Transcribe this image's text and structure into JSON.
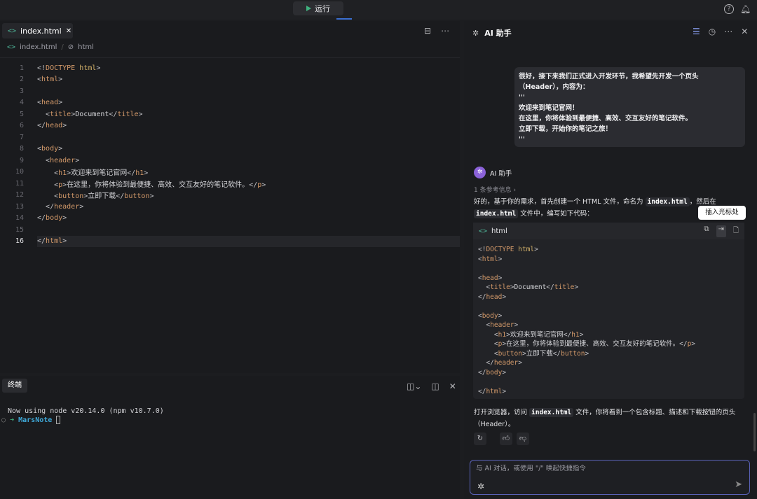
{
  "topbar": {
    "run_label": "运行"
  },
  "editor": {
    "tab_label": "index.html",
    "breadcrumb": [
      "index.html",
      "html"
    ],
    "lines": [
      [
        [
          "p",
          "<!"
        ],
        [
          "k",
          "DOCTYPE"
        ],
        [
          "t",
          " "
        ],
        [
          "d",
          "html"
        ],
        [
          "p",
          ">"
        ]
      ],
      [
        [
          "p",
          "<"
        ],
        [
          "k",
          "html"
        ],
        [
          "p",
          ">"
        ]
      ],
      [],
      [
        [
          "p",
          "<"
        ],
        [
          "k",
          "head"
        ],
        [
          "p",
          ">"
        ]
      ],
      [
        [
          "t",
          "  "
        ],
        [
          "p",
          "<"
        ],
        [
          "k",
          "title"
        ],
        [
          "p",
          ">"
        ],
        [
          "t",
          "Document"
        ],
        [
          "p",
          "</"
        ],
        [
          "k",
          "title"
        ],
        [
          "p",
          ">"
        ]
      ],
      [
        [
          "p",
          "</"
        ],
        [
          "k",
          "head"
        ],
        [
          "p",
          ">"
        ]
      ],
      [],
      [
        [
          "p",
          "<"
        ],
        [
          "k",
          "body"
        ],
        [
          "p",
          ">"
        ]
      ],
      [
        [
          "t",
          "  "
        ],
        [
          "p",
          "<"
        ],
        [
          "k",
          "header"
        ],
        [
          "p",
          ">"
        ]
      ],
      [
        [
          "t",
          "    "
        ],
        [
          "p",
          "<"
        ],
        [
          "k",
          "h1"
        ],
        [
          "p",
          ">"
        ],
        [
          "t",
          "欢迎来到笔记官网"
        ],
        [
          "p",
          "</"
        ],
        [
          "k",
          "h1"
        ],
        [
          "p",
          ">"
        ]
      ],
      [
        [
          "t",
          "    "
        ],
        [
          "p",
          "<"
        ],
        [
          "k",
          "p"
        ],
        [
          "p",
          ">"
        ],
        [
          "t",
          "在这里，你将体验到最便捷、高效、交互友好的笔记软件。"
        ],
        [
          "p",
          "</"
        ],
        [
          "k",
          "p"
        ],
        [
          "p",
          ">"
        ]
      ],
      [
        [
          "t",
          "    "
        ],
        [
          "p",
          "<"
        ],
        [
          "k",
          "button"
        ],
        [
          "p",
          ">"
        ],
        [
          "t",
          "立即下载"
        ],
        [
          "p",
          "</"
        ],
        [
          "k",
          "button"
        ],
        [
          "p",
          ">"
        ]
      ],
      [
        [
          "t",
          "  "
        ],
        [
          "p",
          "</"
        ],
        [
          "k",
          "header"
        ],
        [
          "p",
          ">"
        ]
      ],
      [
        [
          "p",
          "</"
        ],
        [
          "k",
          "body"
        ],
        [
          "p",
          ">"
        ]
      ],
      [],
      [
        [
          "p",
          "</"
        ],
        [
          "k",
          "html"
        ],
        [
          "p",
          ">"
        ]
      ]
    ],
    "current_line": 16
  },
  "terminal": {
    "tab_label": "终端",
    "line1": "Now using node v20.14.0 (npm v10.7.0)",
    "prompt_dir": "MarsNote"
  },
  "assistant": {
    "title": "AI 助手",
    "user_message": [
      "很好，接下来我们正式进入开发环节，我希望先开发一个页头",
      "（Header），内容为：",
      "'''",
      "欢迎来到笔记官网！",
      "在这里，你将体验到最便捷、高效、交互友好的笔记软件。",
      "立即下载，开始你的笔记之旅！",
      "'''"
    ],
    "bot_name": "AI 助手",
    "references": "1 条参考信息",
    "intro_a": "好的，基于你的需求，首先创建一个 HTML 文件，命名为",
    "intro_code": "index.html",
    "intro_b": "，然后在",
    "intro_code2": "index.html",
    "intro_c": "文件中，编写如下代码：",
    "code_lang": "html",
    "tooltip": "插入光标处",
    "outro_a": "打开浏览器，访问",
    "outro_code": "index.html",
    "outro_b": "文件，你将看到一个包含标题、描述和下载按钮的页头（Header）。",
    "input_placeholder": "与 AI 对话，或使用 \"/\" 唤起快捷指令"
  }
}
